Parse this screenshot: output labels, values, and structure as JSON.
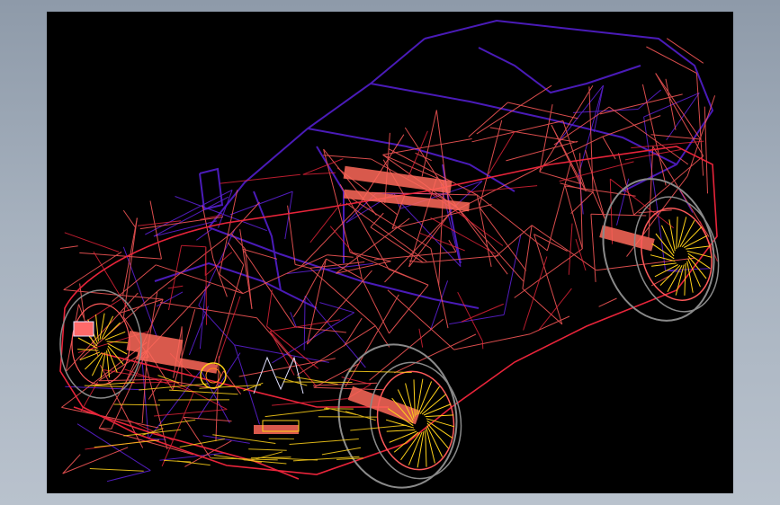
{
  "viewport": {
    "background": "#000000",
    "render_mode": "wireframe",
    "subject": "car-model",
    "colors": {
      "frame_purple": "#4a1bb8",
      "body_salmon": "#ff5a5a",
      "body_red": "#e8243a",
      "wheel_grey": "#8a8a8a",
      "light_yellow": "#ffd21a",
      "highlight_white": "#e0e0ff"
    }
  }
}
